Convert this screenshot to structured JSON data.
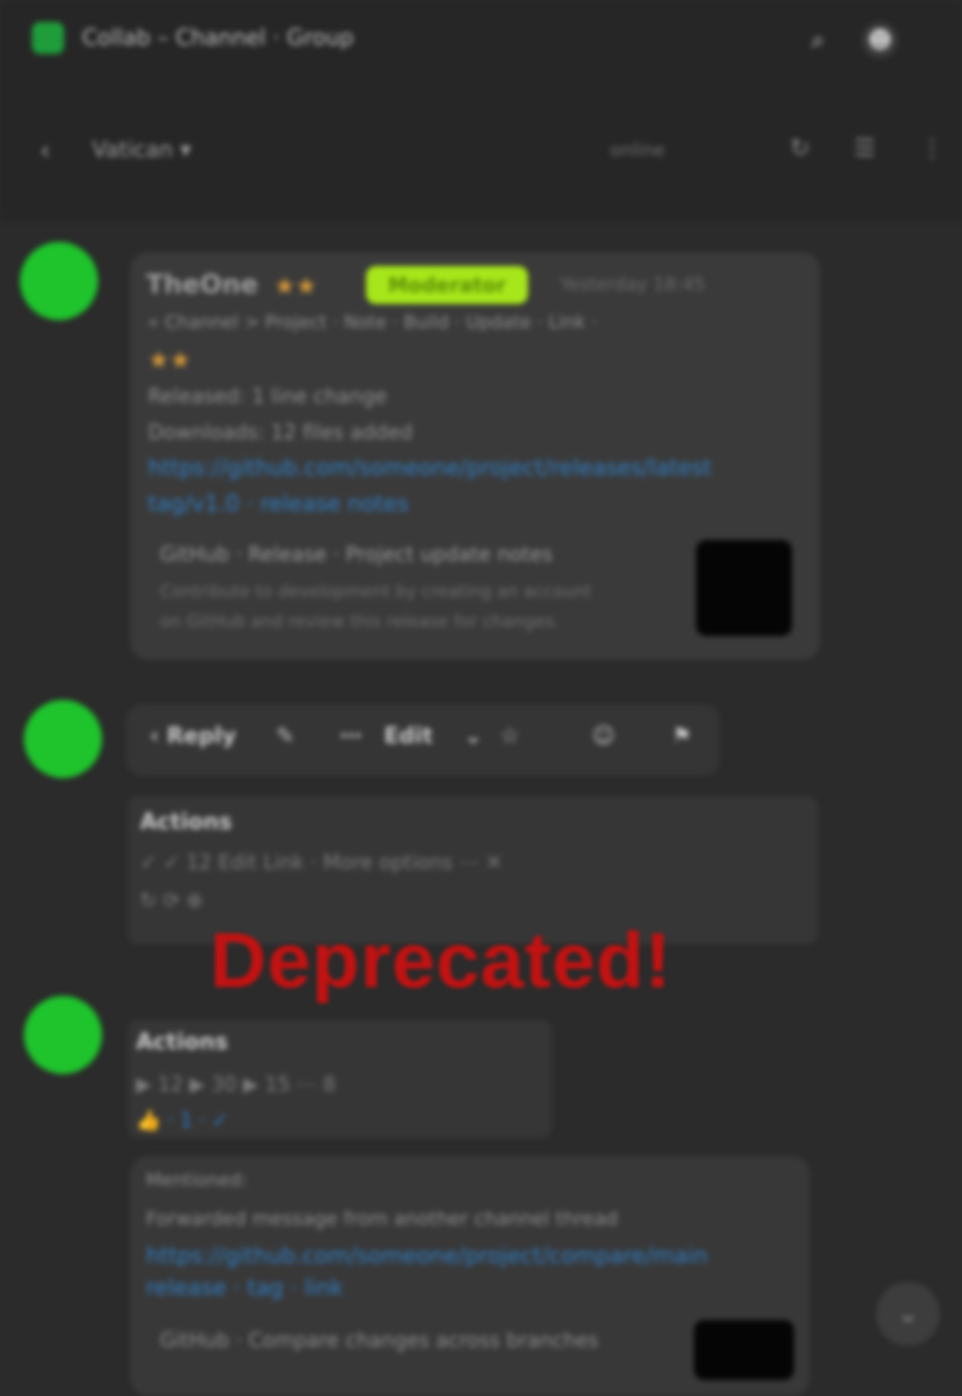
{
  "header": {
    "title": "Collab – Channel · Group",
    "icons": [
      "search-icon",
      "avatar-icon"
    ]
  },
  "subbar": {
    "back_icon": "‹",
    "channel": "Vatican ▾",
    "meta": "online",
    "icons": [
      "↻",
      "☰",
      "⋮"
    ]
  },
  "message1": {
    "author": "TheOne",
    "author_badge": "★★",
    "role_badge": "Moderator",
    "time": "Yesterday 18:45",
    "line1": "« Channel > Project · Note · Build · Update · Link ·",
    "badge2": "★★",
    "line2": "Released: 1 line change",
    "line3": "Downloads: 12 files added",
    "link1": "https://github.com/someone/project/releases/latest",
    "link2": "tag/v1.0 · release notes",
    "preview_title": "GitHub · Release · Project update notes",
    "preview_desc1": "Contribute to development by creating an account",
    "preview_desc2": "on GitHub and review this release for changes."
  },
  "toolbar": {
    "items": [
      "‹ Reply",
      "✎",
      "⋯",
      "Edit",
      "⌄",
      "☆",
      "☺",
      "⚑"
    ]
  },
  "panel1": {
    "title": "Actions",
    "row1": "✓ ✓ 12          Edit      Link · More options   ⋯  ✕",
    "row2": "↻  ⟳  ⊕"
  },
  "overlay": {
    "text": "Deprecated!"
  },
  "panel2": {
    "title": "Actions",
    "row1": "   ▶ 12  ▶ 30  ▶ 15           ⋯ 8",
    "row2": "👍   ·   1   ·   ✓"
  },
  "message2": {
    "line1": "Mentioned:",
    "line2": "Forwarded message from another channel thread",
    "link1": "https://github.com/someone/project/compare/main",
    "link2": "release · tag · link",
    "preview_title": "GitHub · Compare changes across branches"
  },
  "fab": {
    "icon": "⌄"
  },
  "colors": {
    "background": "#2b2b2b",
    "avatar": "#1fc42c",
    "accent_lime": "#a7e61a",
    "overlay_red": "#c31212",
    "link": "#2f7ec4"
  }
}
